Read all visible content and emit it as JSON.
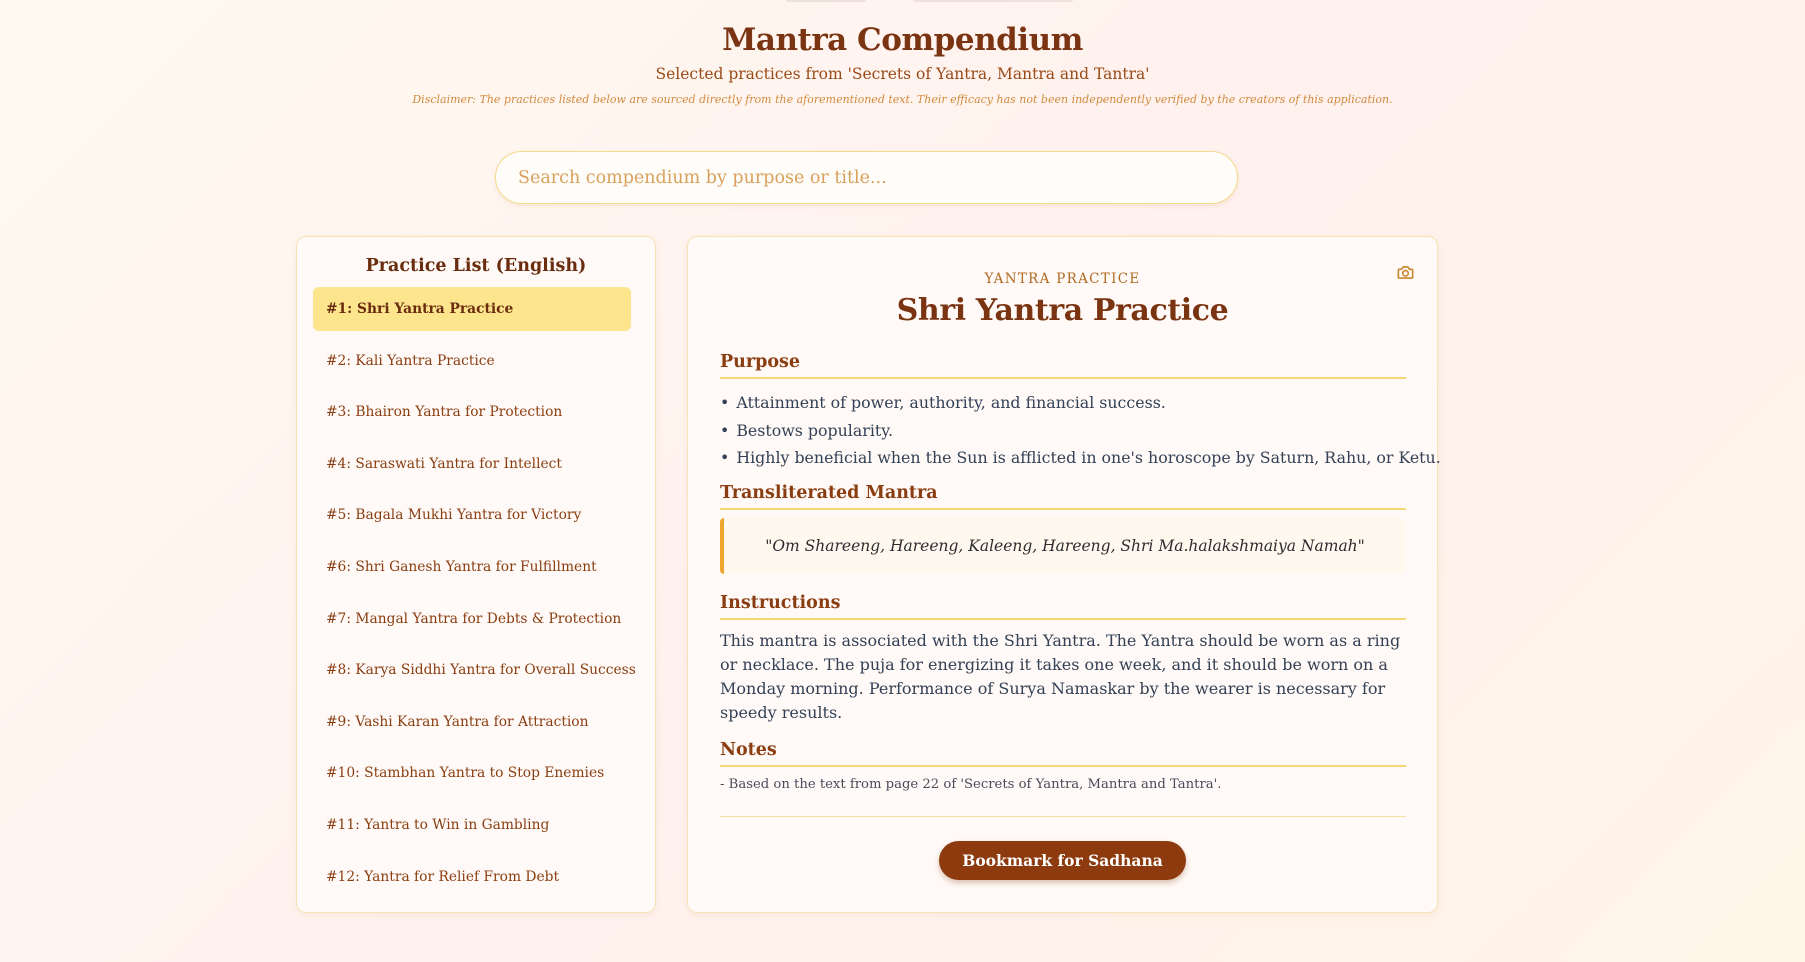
{
  "header": {
    "title": "Mantra Compendium",
    "subtitle": "Selected practices from 'Secrets of Yantra, Mantra and Tantra'",
    "disclaimer": "Disclaimer: The practices listed below are sourced directly from the aforementioned text. Their efficacy has not been independently verified by the creators of this application."
  },
  "search": {
    "placeholder": "Search compendium by purpose or title...",
    "value": ""
  },
  "practice_list": {
    "title": "Practice List (English)",
    "items": [
      {
        "label": "#1: Shri Yantra Practice",
        "active": true
      },
      {
        "label": "#2: Kali Yantra Practice"
      },
      {
        "label": "#3: Bhairon Yantra for Protection"
      },
      {
        "label": "#4: Saraswati Yantra for Intellect"
      },
      {
        "label": "#5: Bagala Mukhi Yantra for Victory"
      },
      {
        "label": "#6: Shri Ganesh Yantra for Fulfillment"
      },
      {
        "label": "#7: Mangal Yantra for Debts & Protection"
      },
      {
        "label": "#8: Karya Siddhi Yantra for Overall Success"
      },
      {
        "label": "#9: Vashi Karan Yantra for Attraction"
      },
      {
        "label": "#10: Stambhan Yantra to Stop Enemies"
      },
      {
        "label": "#11: Yantra to Win in Gambling"
      },
      {
        "label": "#12: Yantra for Relief From Debt"
      }
    ]
  },
  "detail": {
    "kind": "YANTRA PRACTICE",
    "title": "Shri Yantra Practice",
    "camera_icon": "camera-icon",
    "purpose": {
      "heading": "Purpose",
      "items": [
        "Attainment of power, authority, and financial success.",
        "Bestows popularity.",
        "Highly beneficial when the Sun is afflicted in one's horoscope by Saturn, Rahu, or Ketu."
      ]
    },
    "mantra": {
      "heading": "Transliterated Mantra",
      "text": "\"Om Shareeng, Hareeng, Kaleeng, Hareeng, Shri Ma.halakshmaiya Namah\""
    },
    "instructions": {
      "heading": "Instructions",
      "text": "This mantra is associated with the Shri Yantra. The Yantra should be worn as a ring or necklace. The puja for energizing it takes one week, and it should be worn on a Monday morning. Performance of Surya Namaskar by the wearer is necessary for speedy results."
    },
    "notes": {
      "heading": "Notes",
      "text": "- Based on the text from page 22 of 'Secrets of Yantra, Mantra and Tantra'."
    },
    "bookmark_label": "Bookmark for Sadhana"
  },
  "colors": {
    "accent": "#7a3412",
    "active_item_bg": "#fde58e",
    "button_bg": "#8c3a0e",
    "mantra_border": "#f0a52c",
    "heading_rule": "#f6d873"
  }
}
